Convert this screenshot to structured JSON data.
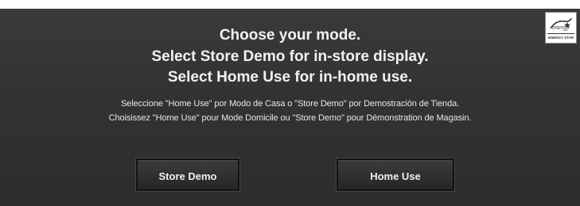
{
  "heading": {
    "line1": "Choose your mode.",
    "line2": "Select Store Demo for in-store display.",
    "line3": "Select Home Use for in-home use."
  },
  "subtext": {
    "spanish": "Seleccione \"Home Use\" por Modo de Casa o \"Store Demo\" por Demostración de Tienda.",
    "french": "Choisissez \"Home Use\" pour Mode Domicile ou \"Store Demo\" pour Démonstration de Magasin."
  },
  "buttons": {
    "store_demo": "Store Demo",
    "home_use": "Home Use"
  },
  "logo": {
    "icon": "energy-star-icon",
    "text": "ENERGY STAR"
  },
  "colors": {
    "background": "#333333",
    "button": "#2a2a2a",
    "text": "#f2f2f2"
  }
}
